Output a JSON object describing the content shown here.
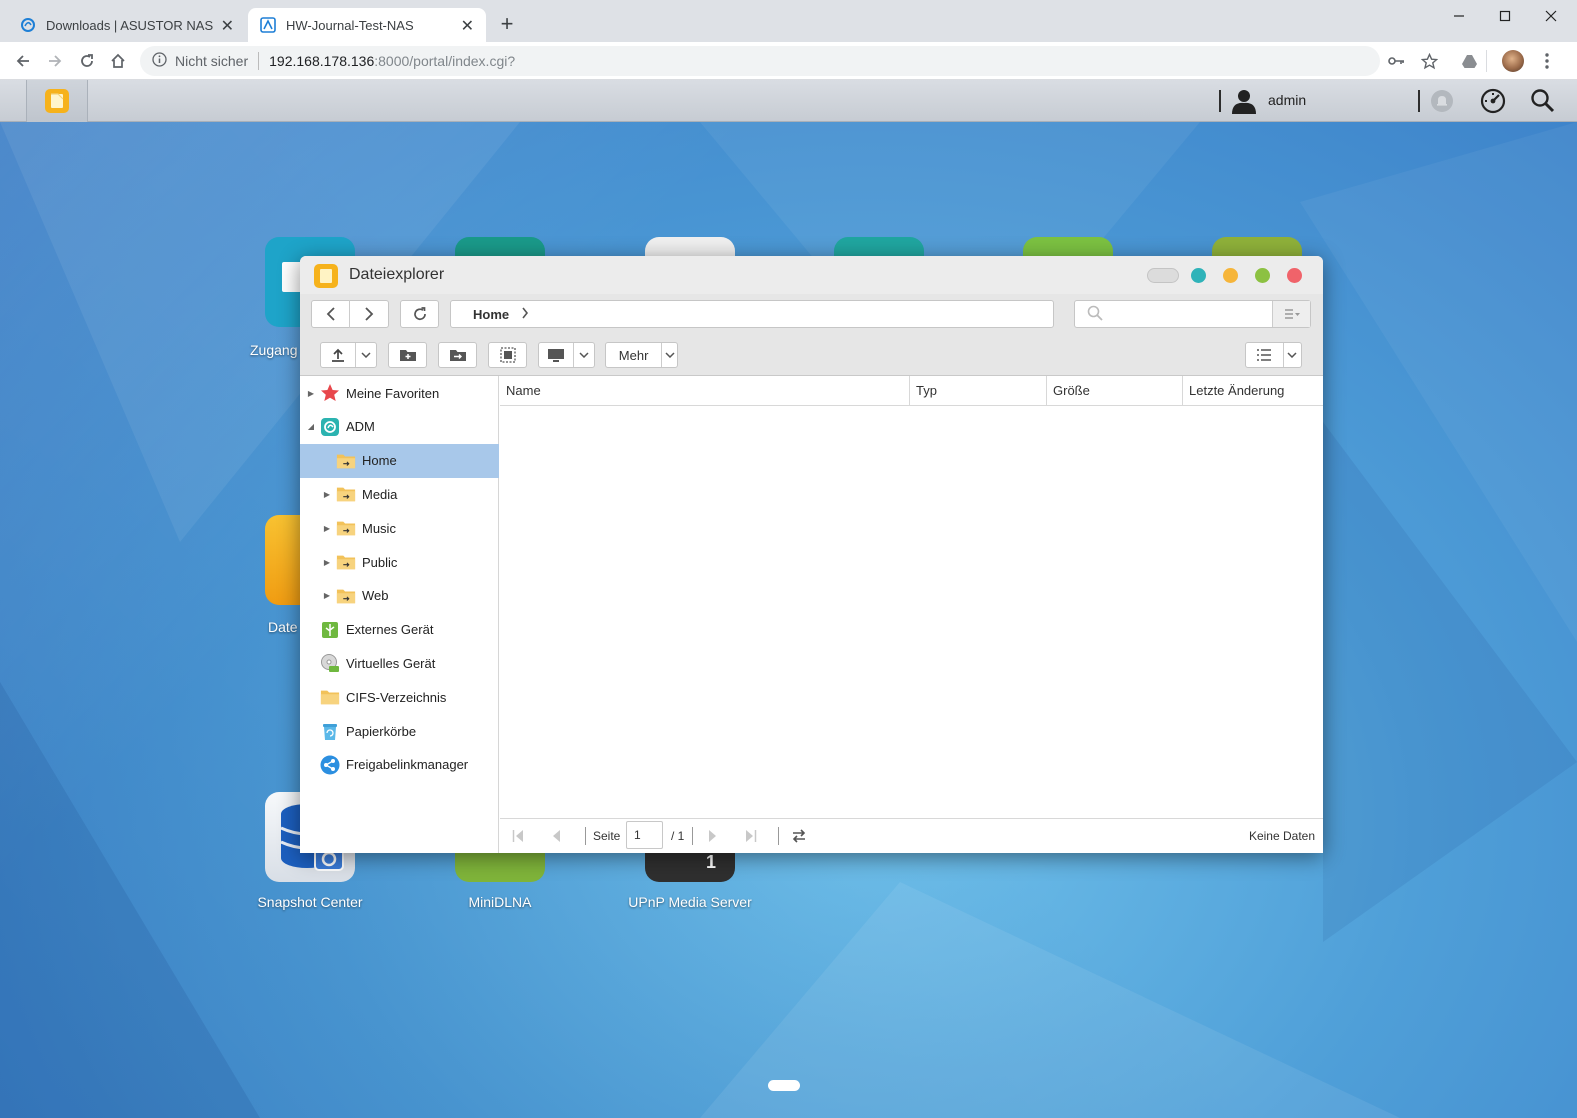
{
  "browser": {
    "tabs": [
      {
        "title": "Downloads | ASUSTOR NAS",
        "close": "✕"
      },
      {
        "title": "HW-Journal-Test-NAS",
        "close": "✕"
      }
    ],
    "new_tab": "+",
    "security_label": "Nicht sicher",
    "url_host": "192.168.178.136",
    "url_path": ":8000/portal/index.cgi?"
  },
  "adm": {
    "user": "admin"
  },
  "desktop": {
    "apps": [
      {
        "label": "Zugang",
        "color": "#1ea4c9"
      },
      {
        "label": "Date",
        "color": "#f2b01e"
      },
      {
        "label": "Snapshot Center",
        "color": "#e8edf3"
      },
      {
        "label": "MiniDLNA",
        "color": "#7fb43a"
      },
      {
        "label": "UPnP Media Server",
        "color": "#333333",
        "badge": "1"
      }
    ]
  },
  "explorer": {
    "title": "Dateiexplorer",
    "breadcrumb": "Home",
    "more_button": "Mehr",
    "search_placeholder": "",
    "tree": [
      {
        "label": "Meine Favoriten",
        "icon": "star-icon",
        "level": 0,
        "expander": "▶"
      },
      {
        "label": "ADM",
        "icon": "adm-icon",
        "level": 0,
        "expander": "◢"
      },
      {
        "label": "Home",
        "icon": "shared-folder-icon",
        "level": 1,
        "expander": ""
      },
      {
        "label": "Media",
        "icon": "shared-folder-icon",
        "level": 1,
        "expander": "▶"
      },
      {
        "label": "Music",
        "icon": "shared-folder-icon",
        "level": 1,
        "expander": "▶"
      },
      {
        "label": "Public",
        "icon": "shared-folder-icon",
        "level": 1,
        "expander": "▶"
      },
      {
        "label": "Web",
        "icon": "shared-folder-icon",
        "level": 1,
        "expander": "▶"
      },
      {
        "label": "Externes Gerät",
        "icon": "usb-icon",
        "level": 0,
        "expander": ""
      },
      {
        "label": "Virtuelles Gerät",
        "icon": "disc-icon",
        "level": 0,
        "expander": ""
      },
      {
        "label": "CIFS-Verzeichnis",
        "icon": "folder-icon",
        "level": 0,
        "expander": ""
      },
      {
        "label": "Papierkörbe",
        "icon": "recycle-bin-icon",
        "level": 0,
        "expander": ""
      },
      {
        "label": "Freigabelinkmanager",
        "icon": "share-icon",
        "level": 0,
        "expander": ""
      }
    ],
    "columns": [
      "Name",
      "Typ",
      "Größe",
      "Letzte Änderung"
    ],
    "pager": {
      "page_label": "Seite",
      "page_value": "1",
      "page_total": "/ 1",
      "status": "Keine Daten"
    }
  }
}
